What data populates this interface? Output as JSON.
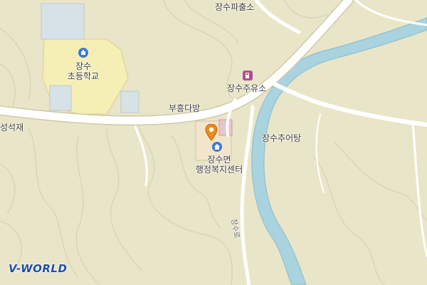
{
  "map": {
    "labels": {
      "police": "장수파출소",
      "gas_station": "장수주유소",
      "school": "장수\n초등학교",
      "tea_house": "부흥다방",
      "stone": "성석재",
      "office": "장수면\n행정복지센터",
      "fish_soup": "장수추어탕",
      "road": "장수로"
    },
    "icons": {
      "school": "school-icon",
      "gas_station": "gas-station-icon",
      "office": "government-office-icon",
      "pin": "location-pin-icon"
    },
    "colors": {
      "land": "#e9e5c8",
      "river": "#a9d3de",
      "road": "#ffffff",
      "school_area": "#f6efb5",
      "contour": "#d9d2ad",
      "pin": "#f08a1c",
      "poi_blue": "#3a7bd5",
      "poi_purple": "#b44c8c"
    }
  },
  "branding": {
    "logo": "V-WORLD"
  }
}
